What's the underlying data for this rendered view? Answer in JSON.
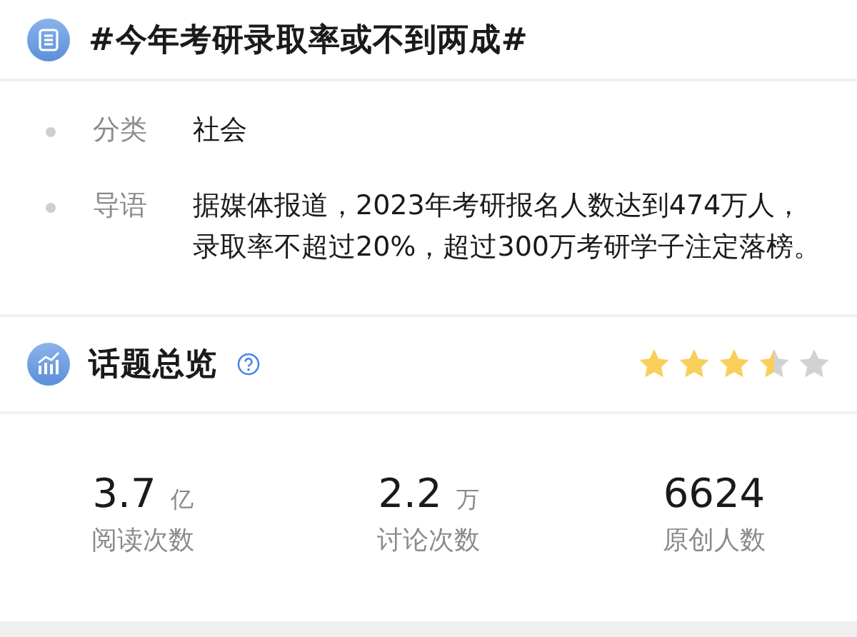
{
  "topic": {
    "title": "#今年考研录取率或不到两成#"
  },
  "details": [
    {
      "label": "分类",
      "value": "社会"
    },
    {
      "label": "导语",
      "value": "据媒体报道，2023年考研报名人数达到474万人，录取率不超过20%，超过300万考研学子注定落榜。"
    }
  ],
  "overview": {
    "title": "话题总览",
    "stars": 3.5,
    "stats": [
      {
        "number": "3.7",
        "unit": "亿",
        "label": "阅读次数"
      },
      {
        "number": "2.2",
        "unit": "万",
        "label": "讨论次数"
      },
      {
        "number": "6624",
        "label": "原创人数"
      }
    ]
  }
}
